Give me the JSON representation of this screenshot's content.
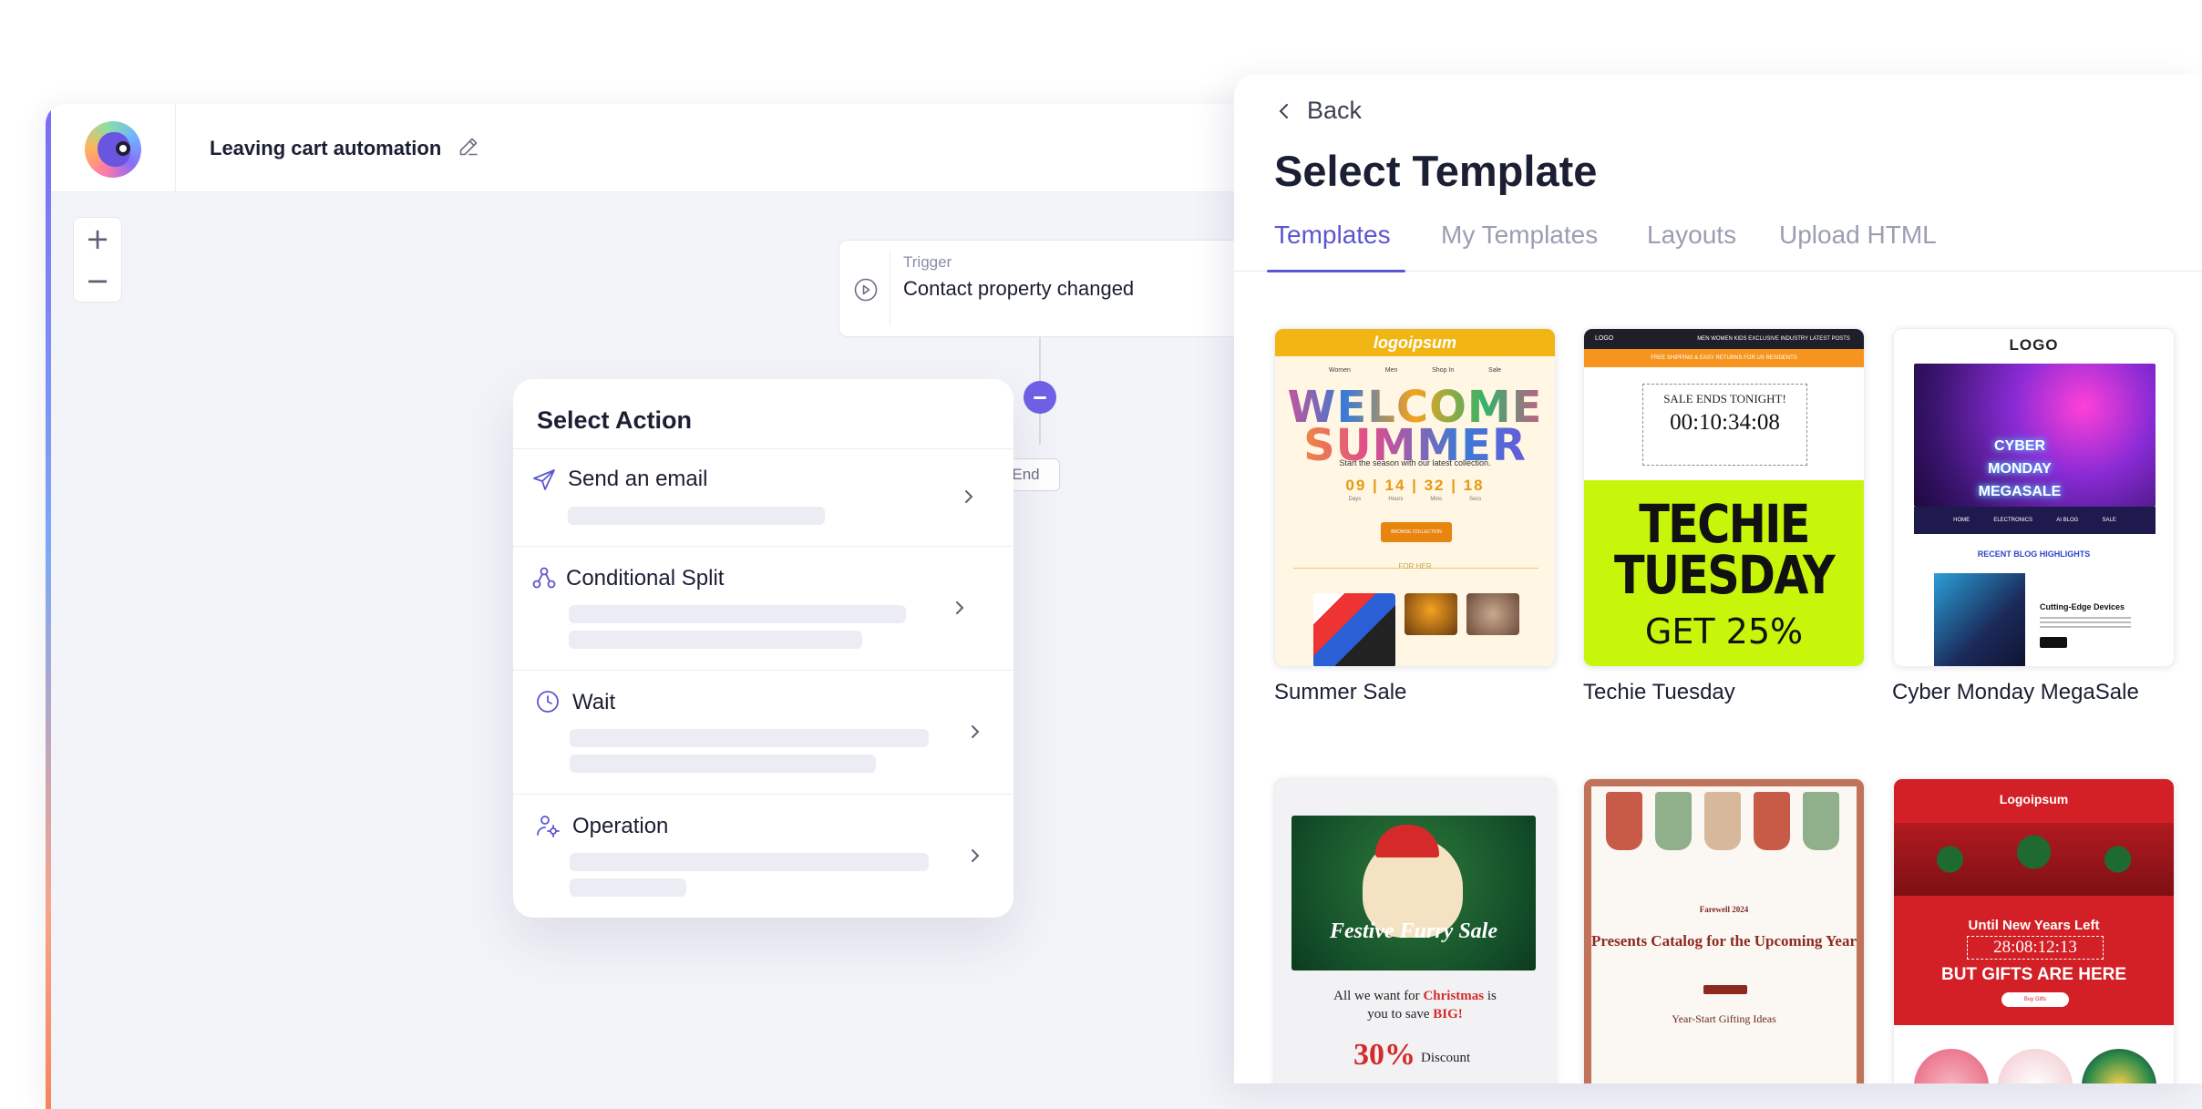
{
  "app": {
    "title": "Leaving cart automation",
    "zoom_in": "+",
    "zoom_out": "−"
  },
  "trigger": {
    "label": "Trigger",
    "value": "Contact property changed"
  },
  "flow": {
    "end_label": "End"
  },
  "action_panel": {
    "title": "Select Action",
    "items": [
      {
        "label": "Send an email",
        "icon": "send-icon"
      },
      {
        "label": "Conditional Split",
        "icon": "split-icon"
      },
      {
        "label": "Wait",
        "icon": "clock-icon"
      },
      {
        "label": "Operation",
        "icon": "operation-icon"
      }
    ]
  },
  "template_panel": {
    "back_label": "Back",
    "title": "Select Template",
    "tabs": [
      "Templates",
      "My Templates",
      "Layouts",
      "Upload HTML"
    ],
    "active_tab": "Templates",
    "templates": [
      {
        "name": "Summer Sale"
      },
      {
        "name": "Techie Tuesday"
      },
      {
        "name": "Cyber Monday MegaSale"
      }
    ],
    "thumb_text": {
      "summer_logo": "logoipsum",
      "summer_nav": [
        "Women",
        "Men",
        "Shop In",
        "Sale"
      ],
      "summer_w": "WELCOME",
      "summer_s": "SUMMER",
      "summer_sub": "Start the season with our latest collection.",
      "summer_count": "09 | 14 | 32 | 18",
      "summer_count_labels": [
        "Days",
        "Hours",
        "Mins",
        "Secs"
      ],
      "summer_btn": "BROWSE COLLECTION",
      "summer_forher": "FOR HER",
      "techie_logo": "LOGO",
      "techie_nav": "MEN  WOMEN  KIDS  EXCLUSIVE  INDUSTRY  LATEST POSTS",
      "techie_ship": "FREE SHIPPING & EASY RETURNS FOR US RESIDENTS",
      "techie_sale": "SALE ENDS TONIGHT!",
      "techie_timer": "00:10:34:08",
      "techie_big": "TECHIE TUESDAY",
      "techie_get": "GET 25%",
      "cyber_logo": "LOGO",
      "cyber_hero": "CYBER MONDAY MEGASALE",
      "cyber_nav": [
        "HOME",
        "ELECTRONICS",
        "AI BLOG",
        "SALE"
      ],
      "cyber_recent": "RECENT BLOG HIGHLIGHTS",
      "cyber_blog": "Cutting-Edge Devices",
      "furry_title": "Festive Furry Sale",
      "furry_line1": "All we want for",
      "furry_christmas": "Christmas",
      "furry_is": "is",
      "furry_line2": "you to save",
      "furry_big": "BIG!",
      "furry_pct": "30%",
      "furry_discount": "Discount",
      "farewell_label": "Farewell 2024",
      "farewell_title": "Presents Catalog for the Upcoming Year",
      "farewell_gift": "Year-Start Gifting Ideas",
      "red_logo": "Logoipsum",
      "red_until": "Until New Years Left",
      "red_timer": "28:08:12:13",
      "red_but": "BUT GIFTS ARE HERE",
      "red_btn": "Buy Gifts"
    }
  },
  "colors": {
    "accent": "#5b56cf",
    "node": "#7060e6",
    "canvas": "#f3f4f9"
  }
}
